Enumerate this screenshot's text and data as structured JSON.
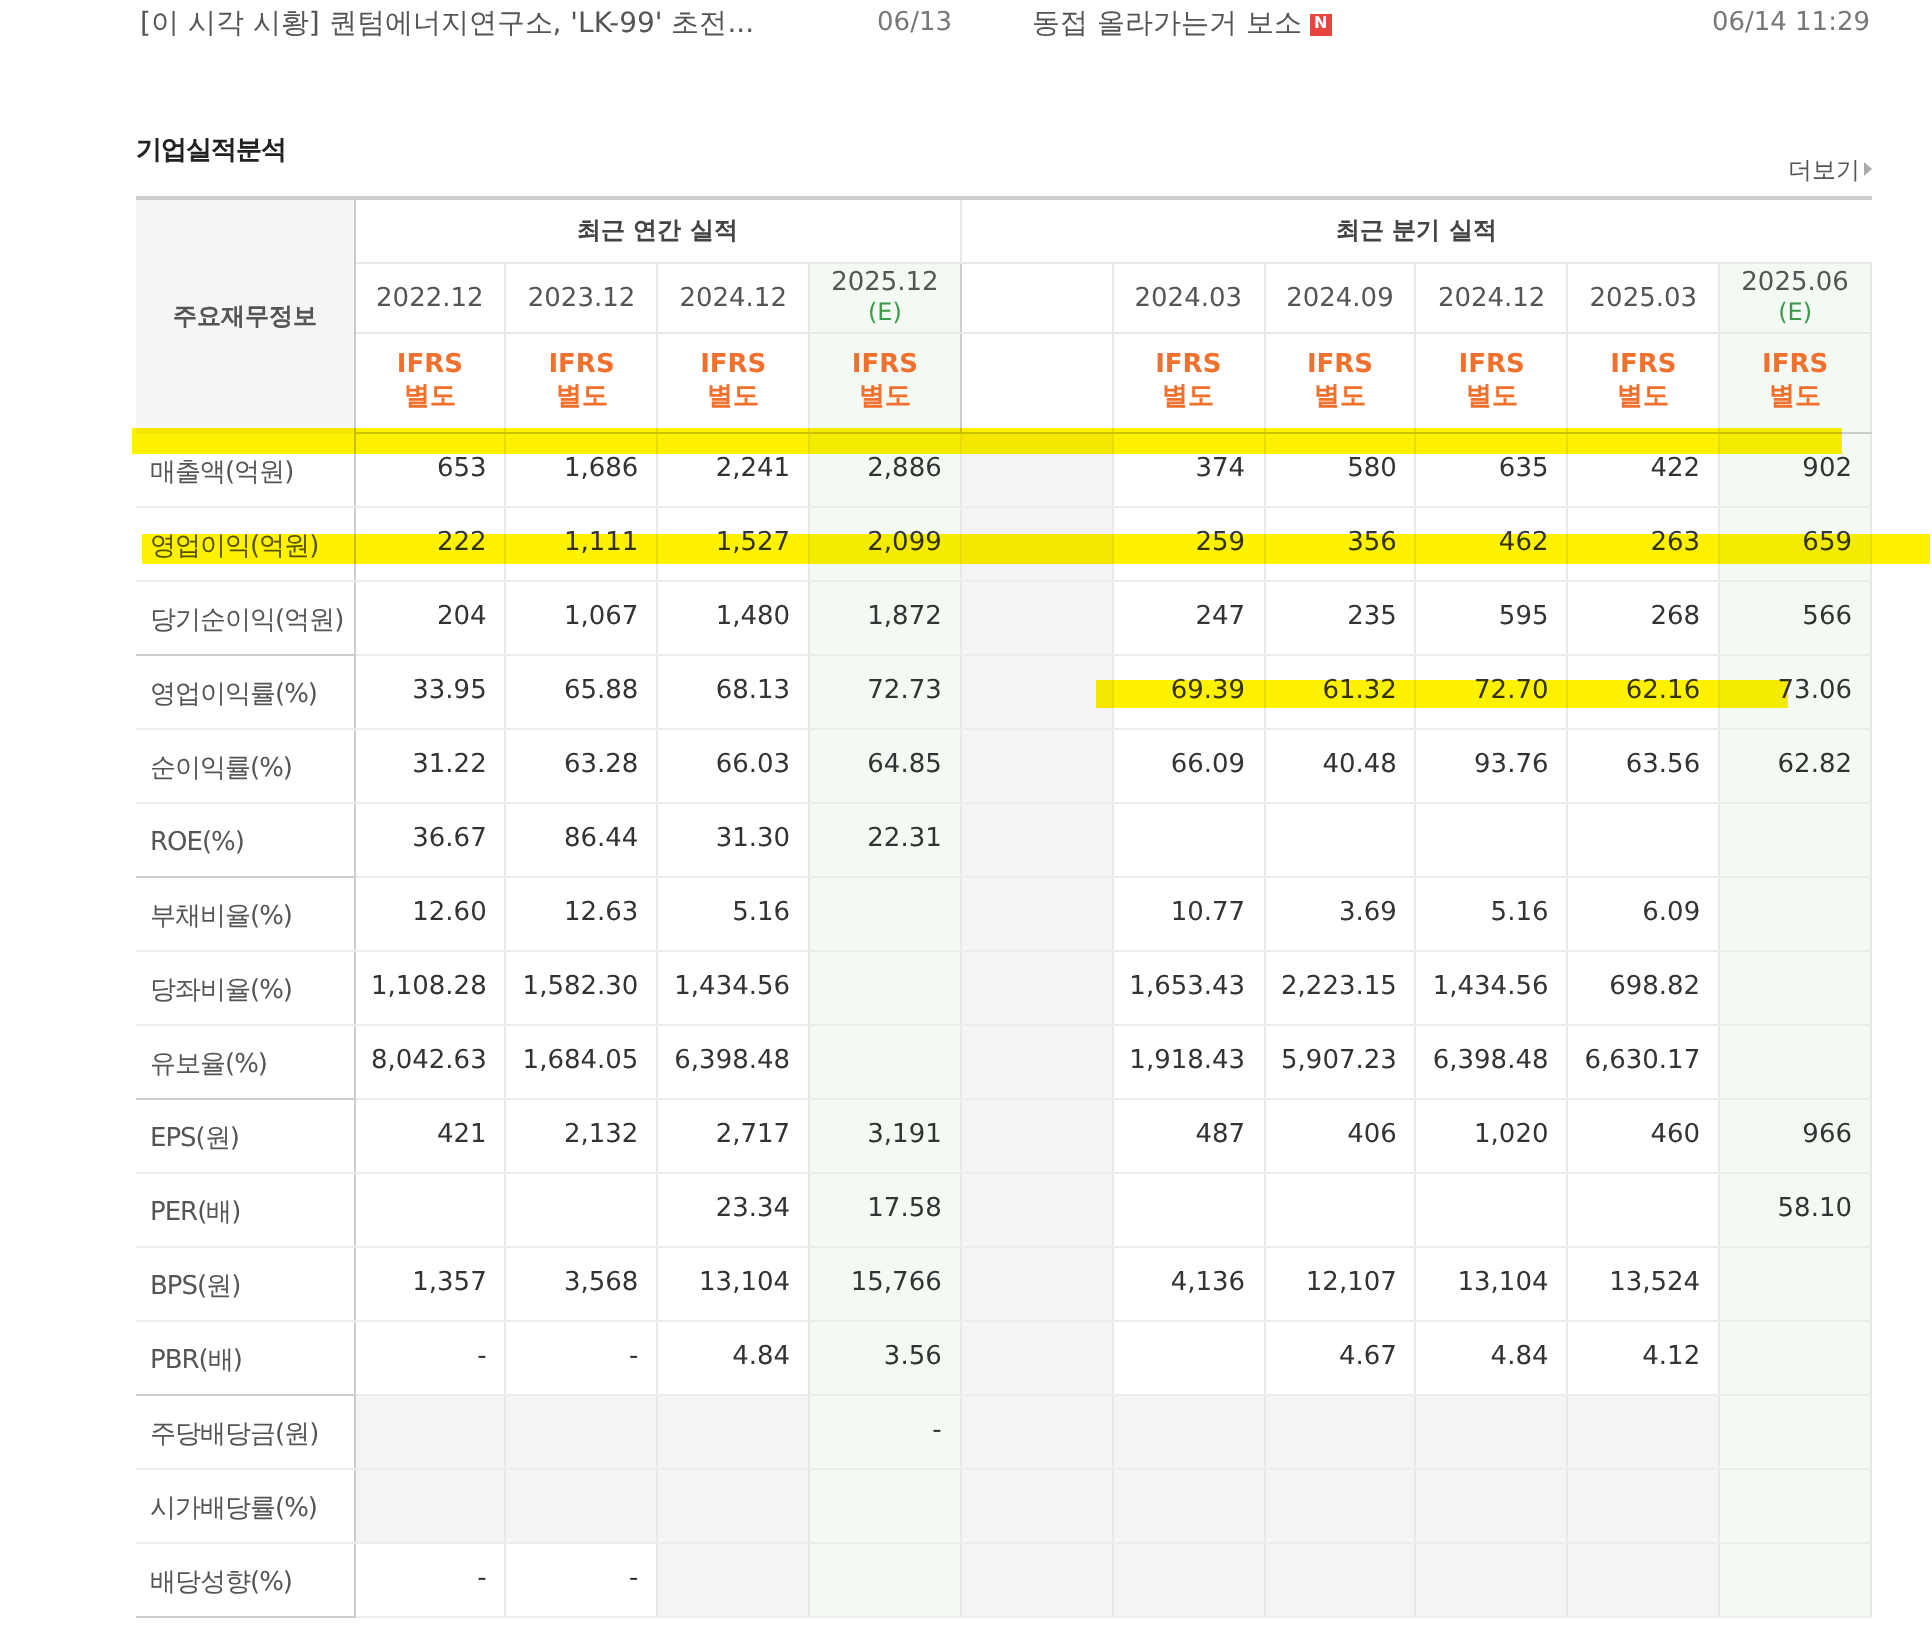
{
  "news": [
    {
      "title": "[이 시각 시황] 퀀텀에너지연구소, 'LK-99' 초전...",
      "date": "06/13"
    },
    {
      "title": "동접 올라가는거 보소",
      "new": true,
      "badge": "N",
      "date": "06/14 11:29"
    }
  ],
  "section": {
    "title": "기업실적분석",
    "more": "더보기"
  },
  "table": {
    "corner": "주요재무정보",
    "header_highlight": true,
    "annual": {
      "title": "최근 연간 실적",
      "columns": [
        {
          "label": "2022.12",
          "estimate": false,
          "basis": "IFRS 별도"
        },
        {
          "label": "2023.12",
          "estimate": false,
          "basis": "IFRS 별도"
        },
        {
          "label": "2024.12",
          "estimate": false,
          "basis": "IFRS 별도"
        },
        {
          "label": "2025.12",
          "estimate": true,
          "mark": "(E)",
          "basis": "IFRS 별도"
        }
      ]
    },
    "quarterly": {
      "title": "최근 분기 실적",
      "columns": [
        {
          "label": "2024.03",
          "estimate": false,
          "basis": "IFRS 별도"
        },
        {
          "label": "2024.09",
          "estimate": false,
          "basis": "IFRS 별도"
        },
        {
          "label": "2024.12",
          "estimate": false,
          "basis": "IFRS 별도"
        },
        {
          "label": "2025.03",
          "estimate": false,
          "basis": "IFRS 별도"
        },
        {
          "label": "2025.06",
          "estimate": true,
          "mark": "(E)",
          "basis": "IFRS 별도"
        }
      ]
    },
    "groups": [
      {
        "rows": [
          {
            "label": "매출액(억원)",
            "annual": [
              "653",
              "1,686",
              "2,241",
              "2,886"
            ],
            "quarterly": [
              "374",
              "580",
              "635",
              "422",
              "902"
            ]
          },
          {
            "label": "영업이익(억원)",
            "highlighted": true,
            "annual": [
              "222",
              "1,111",
              "1,527",
              "2,099"
            ],
            "quarterly": [
              "259",
              "356",
              "462",
              "263",
              "659"
            ]
          },
          {
            "label": "당기순이익(억원)",
            "annual": [
              "204",
              "1,067",
              "1,480",
              "1,872"
            ],
            "quarterly": [
              "247",
              "235",
              "595",
              "268",
              "566"
            ]
          }
        ]
      },
      {
        "rows": [
          {
            "label": "영업이익률(%)",
            "quarters_highlighted": true,
            "annual": [
              "33.95",
              "65.88",
              "68.13",
              "72.73"
            ],
            "quarterly": [
              "69.39",
              "61.32",
              "72.70",
              "62.16",
              "73.06"
            ]
          },
          {
            "label": "순이익률(%)",
            "annual": [
              "31.22",
              "63.28",
              "66.03",
              "64.85"
            ],
            "quarterly": [
              "66.09",
              "40.48",
              "93.76",
              "63.56",
              "62.82"
            ]
          },
          {
            "label": "ROE(%)",
            "annual": [
              "36.67",
              "86.44",
              "31.30",
              "22.31"
            ],
            "quarterly": [
              {
                "kind": "blank"
              },
              {
                "kind": "blank"
              },
              {
                "kind": "blank"
              },
              {
                "kind": "blank"
              },
              {
                "kind": "blank"
              }
            ]
          }
        ]
      },
      {
        "rows": [
          {
            "label": "부채비율(%)",
            "annual": [
              "12.60",
              "12.63",
              "5.16",
              {
                "kind": "blank"
              }
            ],
            "quarterly": [
              "10.77",
              "3.69",
              "5.16",
              "6.09",
              {
                "kind": "blank"
              }
            ]
          },
          {
            "label": "당좌비율(%)",
            "annual": [
              "1,108.28",
              "1,582.30",
              "1,434.56",
              {
                "kind": "blank"
              }
            ],
            "quarterly": [
              "1,653.43",
              "2,223.15",
              "1,434.56",
              "698.82",
              {
                "kind": "blank"
              }
            ]
          },
          {
            "label": "유보율(%)",
            "annual": [
              "8,042.63",
              "1,684.05",
              "6,398.48",
              {
                "kind": "blank"
              }
            ],
            "quarterly": [
              "1,918.43",
              "5,907.23",
              "6,398.48",
              "6,630.17",
              {
                "kind": "blank"
              }
            ]
          }
        ]
      },
      {
        "rows": [
          {
            "label": "EPS(원)",
            "annual": [
              "421",
              "2,132",
              "2,717",
              "3,191"
            ],
            "quarterly": [
              "487",
              "406",
              "1,020",
              "460",
              "966"
            ]
          },
          {
            "label": "PER(배)",
            "annual": [
              {
                "kind": "blank"
              },
              {
                "kind": "blank"
              },
              "23.34",
              "17.58"
            ],
            "quarterly": [
              {
                "kind": "blank"
              },
              {
                "kind": "blank"
              },
              {
                "kind": "blank"
              },
              {
                "kind": "blank"
              },
              "58.10"
            ]
          },
          {
            "label": "BPS(원)",
            "annual": [
              "1,357",
              "3,568",
              "13,104",
              "15,766"
            ],
            "quarterly": [
              "4,136",
              "12,107",
              "13,104",
              "13,524",
              {
                "kind": "blank"
              }
            ]
          },
          {
            "label": "PBR(배)",
            "annual": [
              "-",
              "-",
              "4.84",
              "3.56"
            ],
            "quarterly": [
              {
                "kind": "blank"
              },
              "4.67",
              "4.84",
              "4.12",
              {
                "kind": "blank"
              }
            ]
          }
        ]
      },
      {
        "rows": [
          {
            "label": "주당배당금(원)",
            "annual": [
              {
                "kind": "na"
              },
              {
                "kind": "na"
              },
              {
                "kind": "na"
              },
              "-"
            ],
            "quarterly": [
              {
                "kind": "na"
              },
              {
                "kind": "na"
              },
              {
                "kind": "na"
              },
              {
                "kind": "na"
              },
              {
                "kind": "na"
              }
            ]
          },
          {
            "label": "시가배당률(%)",
            "annual": [
              {
                "kind": "na"
              },
              {
                "kind": "na"
              },
              {
                "kind": "na"
              },
              {
                "kind": "na"
              }
            ],
            "quarterly": [
              {
                "kind": "na"
              },
              {
                "kind": "na"
              },
              {
                "kind": "na"
              },
              {
                "kind": "na"
              },
              {
                "kind": "na"
              }
            ]
          },
          {
            "label": "배당성향(%)",
            "annual": [
              "-",
              "-",
              {
                "kind": "na"
              },
              {
                "kind": "na"
              }
            ],
            "quarterly": [
              {
                "kind": "na"
              },
              {
                "kind": "na"
              },
              {
                "kind": "na"
              },
              {
                "kind": "na"
              },
              {
                "kind": "na"
              }
            ]
          }
        ]
      }
    ]
  }
}
